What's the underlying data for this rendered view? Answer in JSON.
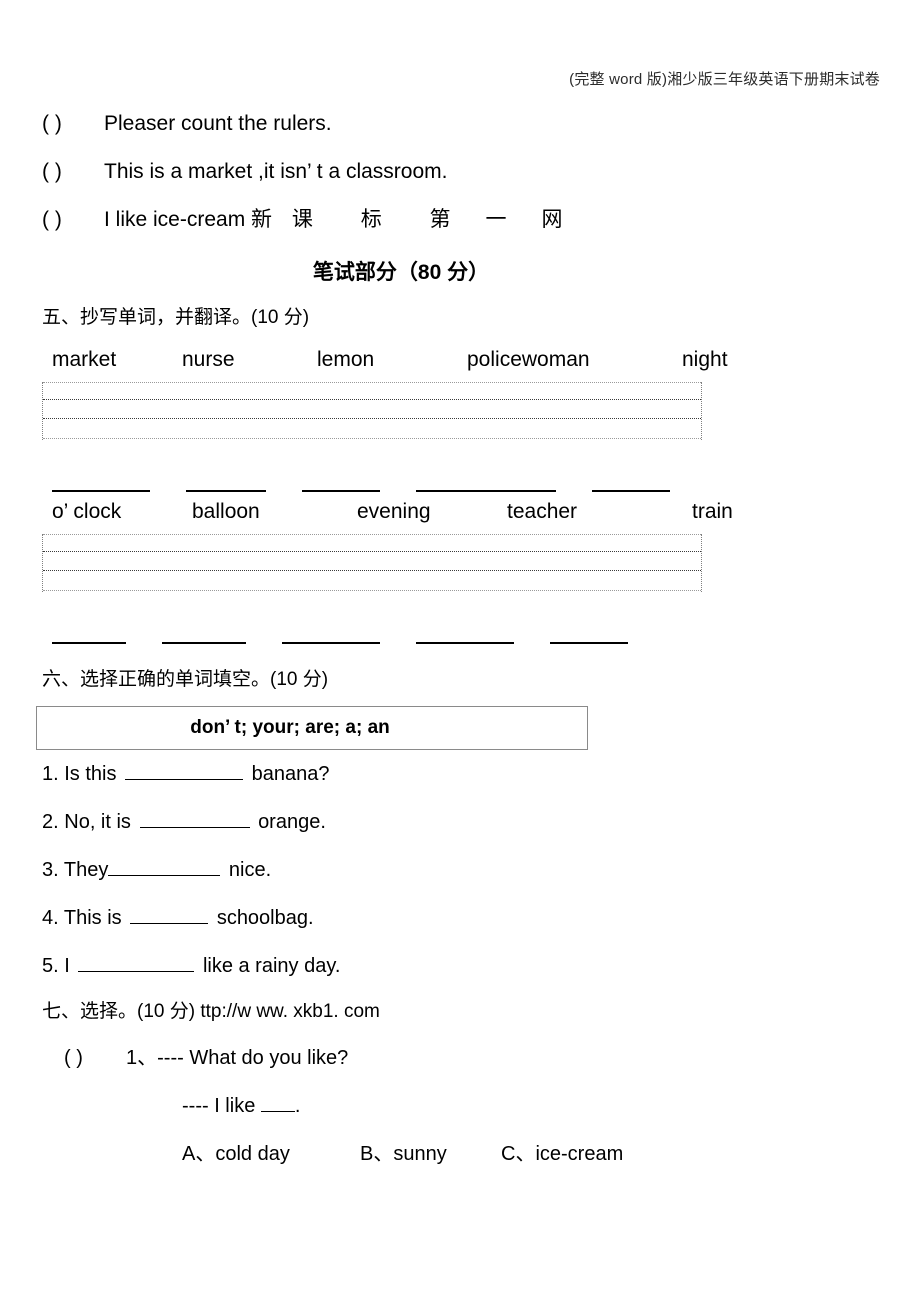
{
  "header": {
    "watermark_title": "(完整 word 版)湘少版三年级英语下册期末试卷"
  },
  "judgement_items": [
    {
      "paren": "(      )",
      "text": "Pleaser count the rulers."
    },
    {
      "paren": "(      )",
      "text": "This is a market ,it isn’ t a classroom."
    },
    {
      "paren": "(      )",
      "text": "I like ice-cream ",
      "watermark": "新 课　 标　 第　一　网"
    }
  ],
  "written_part": {
    "title": "笔试部分（80 分）"
  },
  "section5": {
    "heading": "五、抄写单词，并翻译。(10 分)",
    "words_row1": [
      "market",
      "nurse",
      "lemon",
      "policewoman",
      "night"
    ],
    "words_row2": [
      "o’ clock",
      "balloon",
      "evening",
      "teacher",
      "train"
    ],
    "blank_widths_row1": [
      98,
      80,
      78,
      140,
      78
    ],
    "blank_widths_row2": [
      74,
      84,
      98,
      98,
      78
    ]
  },
  "section6": {
    "heading": "六、选择正确的单词填空。(10 分)",
    "word_bank": "don’ t;   your;   are;   a;   an",
    "items": [
      {
        "num": "1.",
        "before": "Is this",
        "blank_width": 118,
        "after": "banana?"
      },
      {
        "num": "2.",
        "before": "No, it is",
        "blank_width": 110,
        "after": "orange."
      },
      {
        "num": "3.",
        "before": "They",
        "blank_width": 112,
        "after": "nice."
      },
      {
        "num": "4.",
        "before": "This is",
        "blank_width": 78,
        "after": "schoolbag."
      },
      {
        "num": "5.",
        "before": "I",
        "blank_width": 116,
        "after": "like a rainy day."
      }
    ]
  },
  "section7": {
    "heading": "七、选择。(10 分)",
    "watermark": "ttp://w ww.  xkb1. com",
    "question": {
      "paren": "(       )",
      "num": "1、",
      "stem": "---- What do you like?",
      "answer_prefix": "---- I like",
      "answer_suffix": ".",
      "options": [
        "A、cold day",
        "B、sunny",
        "C、ice-cream"
      ]
    }
  }
}
